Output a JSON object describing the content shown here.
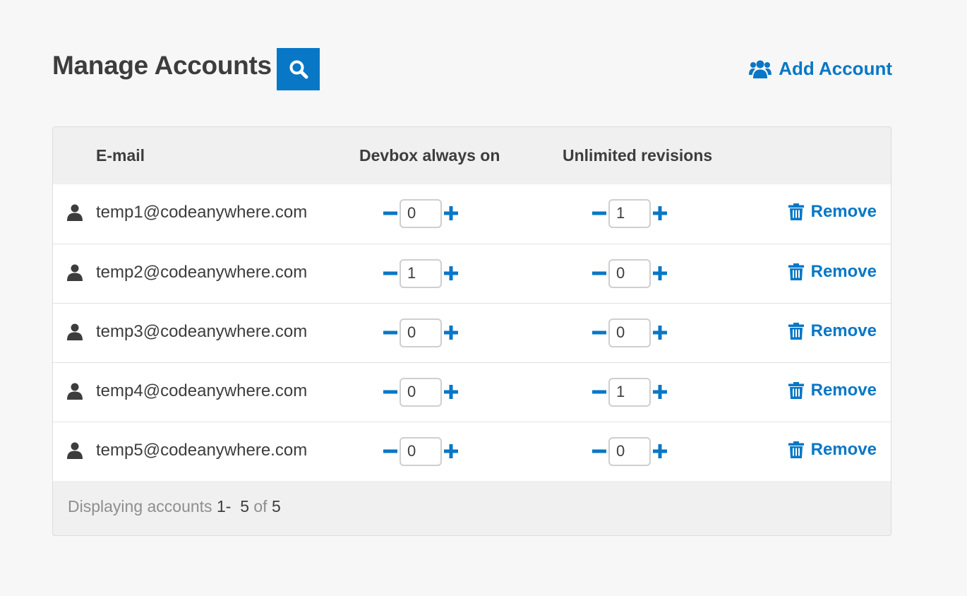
{
  "header": {
    "title": "Manage Accounts",
    "add_account_label": "Add Account"
  },
  "table": {
    "columns": {
      "email": "E-mail",
      "devbox": "Devbox always on",
      "revisions": "Unlimited revisions"
    },
    "rows": [
      {
        "email": "temp1@codeanywhere.com",
        "devbox": "0",
        "revisions": "1",
        "remove_label": "Remove"
      },
      {
        "email": "temp2@codeanywhere.com",
        "devbox": "1",
        "revisions": "0",
        "remove_label": "Remove"
      },
      {
        "email": "temp3@codeanywhere.com",
        "devbox": "0",
        "revisions": "0",
        "remove_label": "Remove"
      },
      {
        "email": "temp4@codeanywhere.com",
        "devbox": "0",
        "revisions": "1",
        "remove_label": "Remove"
      },
      {
        "email": "temp5@codeanywhere.com",
        "devbox": "0",
        "revisions": "0",
        "remove_label": "Remove"
      }
    ]
  },
  "footer": {
    "prefix": "Displaying accounts",
    "range_start": "1",
    "range_sep": "-",
    "range_end": "5",
    "of_label": "of",
    "total": "5"
  },
  "colors": {
    "accent": "#0877c6",
    "page_bg": "#f7f7f7",
    "panel_bg": "#eff0ef",
    "text": "#3d3d3d",
    "muted": "#8e8e8e"
  },
  "icons": {
    "search": "search-icon",
    "add_account": "users-icon",
    "row_user": "user-icon",
    "decrement": "minus-icon",
    "increment": "plus-icon",
    "remove": "trash-icon"
  }
}
